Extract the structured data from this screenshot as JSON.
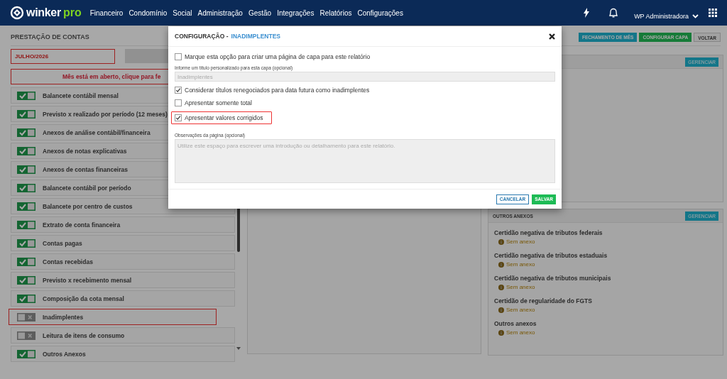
{
  "navbar": {
    "brand": "winker",
    "brand_accent": "pro",
    "menu": [
      "Financeiro",
      "Condomínio",
      "Social",
      "Administração",
      "Gestão",
      "Integrações",
      "Relatórios",
      "Configurações"
    ],
    "user": "WP Administradora"
  },
  "page": {
    "title": "PRESTAÇÃO DE CONTAS",
    "actions": [
      {
        "label": "FECHAMENTO DE MÊS",
        "kind": "info"
      },
      {
        "label": "CONFIGURAR CAPA",
        "kind": "success"
      },
      {
        "label": "VOLTAR",
        "kind": "default"
      }
    ],
    "month": "JULHO/2026",
    "alert": "Mês está em aberto, clique para fe",
    "reports": [
      {
        "label": "Balancete contábil mensal",
        "on": true,
        "highlighted": false
      },
      {
        "label": "Previsto x realizado por período (12 meses)",
        "on": true,
        "highlighted": false
      },
      {
        "label": "Anexos de análise contábil/financeira",
        "on": true,
        "highlighted": false
      },
      {
        "label": "Anexos de notas explicativas",
        "on": true,
        "highlighted": false
      },
      {
        "label": "Anexos de contas financeiras",
        "on": true,
        "highlighted": false
      },
      {
        "label": "Balancete contábil por período",
        "on": true,
        "highlighted": false
      },
      {
        "label": "Balancete por centro de custos",
        "on": true,
        "highlighted": false
      },
      {
        "label": "Extrato de conta financeira",
        "on": true,
        "highlighted": false
      },
      {
        "label": "Contas pagas",
        "on": true,
        "highlighted": false
      },
      {
        "label": "Contas recebidas",
        "on": true,
        "highlighted": false
      },
      {
        "label": "Previsto x recebimento mensal",
        "on": true,
        "highlighted": false
      },
      {
        "label": "Composição da cota mensal",
        "on": true,
        "highlighted": false
      },
      {
        "label": "Inadimplentes",
        "on": false,
        "highlighted": true
      },
      {
        "label": "Leitura de itens de consumo",
        "on": false,
        "highlighted": false
      },
      {
        "label": "Outros Anexos",
        "on": true,
        "highlighted": false
      }
    ]
  },
  "right_panels": [
    {
      "button": "GERENCIAR"
    },
    {
      "title": "OUTROS ANEXOS",
      "button": "GERENCIAR",
      "items": [
        {
          "name": "Certidão negativa de tributos federais",
          "status": "Sem anexo"
        },
        {
          "name": "Certidão negativa de tributos estaduais",
          "status": "Sem anexo"
        },
        {
          "name": "Certidão negativa de tributos municipais",
          "status": "Sem anexo"
        },
        {
          "name": "Certidão de regularidade do FGTS",
          "status": "Sem anexo"
        },
        {
          "name": "Outros anexos",
          "status": "Sem anexo"
        }
      ]
    }
  ],
  "modal": {
    "title": "CONFIGURAÇÃO -",
    "subject": "INADIMPLENTES",
    "fields": [
      {
        "kind": "checkbox",
        "label": "Marque esta opção para criar uma página de capa para este relatório",
        "checked": false,
        "highlighted": false
      },
      {
        "kind": "text",
        "label": "Informe um título personalizado para esta capa (opcional)",
        "placeholder": "Inadimplentes"
      },
      {
        "kind": "checkbox",
        "label": "Considerar títulos renegociados para data futura como inadimplentes",
        "checked": true,
        "highlighted": false
      },
      {
        "kind": "checkbox",
        "label": "Apresentar somente total",
        "checked": false,
        "highlighted": false
      },
      {
        "kind": "checkbox",
        "label": "Apresentar valores corrigidos",
        "checked": true,
        "highlighted": true
      },
      {
        "kind": "textarea",
        "label": "Observações da página (opcional)",
        "placeholder": "Utilize este espaço para escrever uma introdução ou detalhamento para este relatório."
      }
    ],
    "buttons": [
      {
        "label": "CANCELAR",
        "kind": "outline"
      },
      {
        "label": "SALVAR",
        "kind": "success"
      }
    ]
  }
}
